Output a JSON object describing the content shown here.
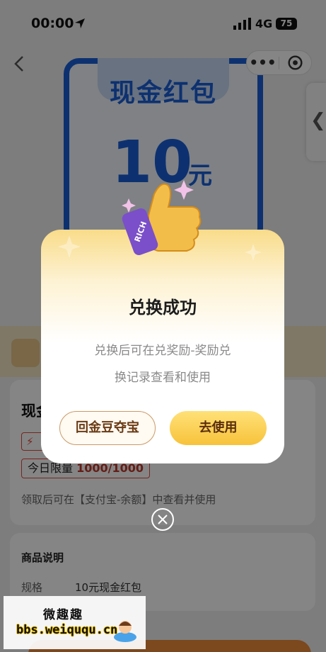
{
  "status_bar": {
    "time": "00:00",
    "network": "4G",
    "battery": "75"
  },
  "packet": {
    "title": "现金红包",
    "amount": "10",
    "unit": "元"
  },
  "product": {
    "title": "现金",
    "flash_label": "",
    "limit_label": "今日限量",
    "limit_value": "1000/1000",
    "hint": "领取后可在【支付宝-余额】中查看并使用"
  },
  "description": {
    "title": "商品说明",
    "spec_key": "规格",
    "spec_value": "10元现金红包"
  },
  "dialog": {
    "badge_text": "RICH",
    "title": "兑换成功",
    "line1": "兑换后可在兑奖励-奖励兑",
    "line2": "换记录查看和使用",
    "back_button": "回金豆夺宝",
    "use_button": "去使用"
  },
  "watermark": {
    "name": "微趣趣",
    "url": "bbs.weiququ.cn"
  },
  "colors": {
    "packet_blue": "#1a5fd6",
    "gold": "#f7c23a",
    "red": "#e04a3c"
  }
}
